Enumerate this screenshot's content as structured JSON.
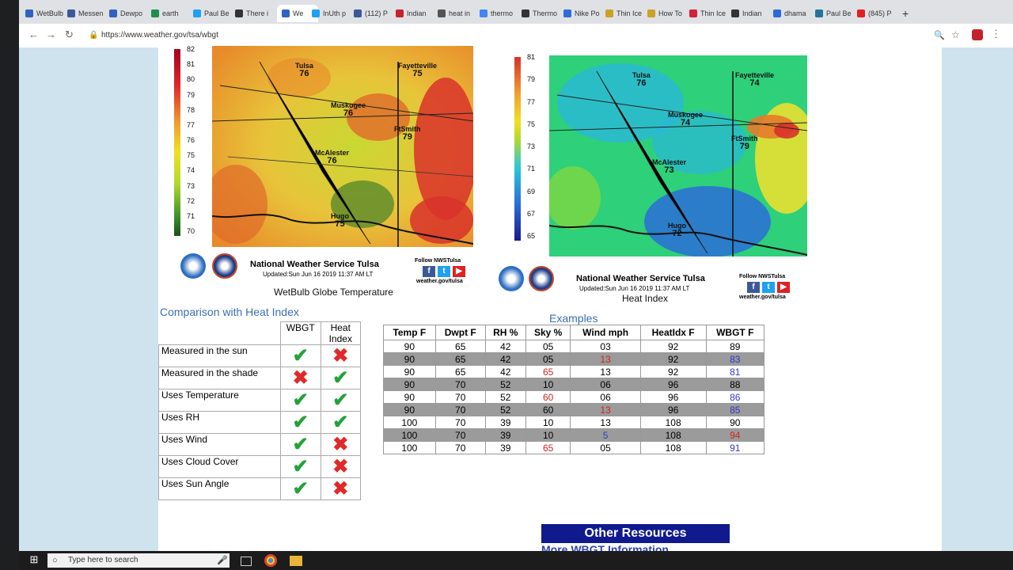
{
  "browser": {
    "tabs": [
      {
        "label": "WetBulb",
        "icon": "nws-icon",
        "color": "#3062c4"
      },
      {
        "label": "Messen",
        "icon": "facebook-icon",
        "color": "#3b5998"
      },
      {
        "label": "Dewpo",
        "icon": "nws-icon",
        "color": "#3062c4"
      },
      {
        "label": "earth",
        "icon": "sheet-icon",
        "color": "#1f8f4d"
      },
      {
        "label": "Paul Be",
        "icon": "twitter-icon",
        "color": "#1da1f2"
      },
      {
        "label": "There i",
        "icon": "page-icon",
        "color": "#333333"
      },
      {
        "label": "We",
        "icon": "nws-icon",
        "color": "#3062c4"
      },
      {
        "label": "InUth p",
        "icon": "twitter-icon",
        "color": "#1da1f2"
      },
      {
        "label": "(112) P",
        "icon": "facebook-icon",
        "color": "#3b5998"
      },
      {
        "label": "Indian",
        "icon": "news-icon",
        "color": "#c4232c"
      },
      {
        "label": "heat in",
        "icon": "page-icon",
        "color": "#555555"
      },
      {
        "label": "thermo",
        "icon": "google-icon",
        "color": "#4285f4"
      },
      {
        "label": "Thermo",
        "icon": "wikipedia-icon",
        "color": "#333333"
      },
      {
        "label": "Nike Po",
        "icon": "page-icon",
        "color": "#2e6bd8"
      },
      {
        "label": "Thin Ice",
        "icon": "page-icon",
        "color": "#c9a227"
      },
      {
        "label": "How To",
        "icon": "page-icon",
        "color": "#c9a227"
      },
      {
        "label": "Thin Ice",
        "icon": "page-icon",
        "color": "#d0223a"
      },
      {
        "label": "Indian",
        "icon": "page-icon",
        "color": "#333333"
      },
      {
        "label": "dhama",
        "icon": "page-icon",
        "color": "#2e6bd8"
      },
      {
        "label": "Paul Be",
        "icon": "wordpress-icon",
        "color": "#21759b"
      },
      {
        "label": "(845) P",
        "icon": "youtube-icon",
        "color": "#e02020"
      }
    ],
    "new_tab_label": "+",
    "url": "https://www.weather.gov/tsa/wbgt"
  },
  "maps": {
    "left": {
      "org": "National Weather Service Tulsa",
      "updated": "Updated:Sun Jun 16 2019 11:37 AM LT",
      "follow": "Follow NWSTulsa",
      "site": "weather.gov/tulsa",
      "caption": "WetBulb Globe Temperature",
      "scale": [
        "82",
        "81",
        "80",
        "79",
        "78",
        "77",
        "76",
        "75",
        "74",
        "73",
        "72",
        "71",
        "70"
      ],
      "cities": [
        {
          "name": "Tulsa",
          "val": "76"
        },
        {
          "name": "Fayetteville",
          "val": "75"
        },
        {
          "name": "Muskogee",
          "val": "76"
        },
        {
          "name": "FtSmith",
          "val": "79"
        },
        {
          "name": "McAlester",
          "val": "76"
        },
        {
          "name": "Hugo",
          "val": "75"
        }
      ],
      "roads": [
        "44",
        "40",
        "40",
        "71",
        "69"
      ]
    },
    "right": {
      "org": "National Weather Service Tulsa",
      "updated": "Updated:Sun Jun 16 2019 11:37 AM LT",
      "follow": "Follow NWSTulsa",
      "site": "weather.gov/tulsa",
      "caption": "Heat Index",
      "scale": [
        "81",
        "79",
        "77",
        "75",
        "73",
        "71",
        "69",
        "67",
        "65"
      ],
      "cities": [
        {
          "name": "Tulsa",
          "val": "76"
        },
        {
          "name": "Fayetteville",
          "val": "74"
        },
        {
          "name": "Muskogee",
          "val": "74"
        },
        {
          "name": "FtSmith",
          "val": "79"
        },
        {
          "name": "McAlester",
          "val": "73"
        },
        {
          "name": "Hugo",
          "val": "72"
        }
      ],
      "roads": [
        "44",
        "40",
        "40",
        "71",
        "69"
      ]
    }
  },
  "comparison": {
    "title": "Comparison with Heat Index",
    "headers": [
      "WBGT",
      "Heat Index"
    ],
    "rows": [
      {
        "label": "Measured in the sun",
        "wbgt": true,
        "hi": false
      },
      {
        "label": "Measured in the shade",
        "wbgt": false,
        "hi": true
      },
      {
        "label": "Uses Temperature",
        "wbgt": true,
        "hi": true
      },
      {
        "label": "Uses RH",
        "wbgt": true,
        "hi": true
      },
      {
        "label": "Uses Wind",
        "wbgt": true,
        "hi": false
      },
      {
        "label": "Uses Cloud Cover",
        "wbgt": true,
        "hi": false
      },
      {
        "label": "Uses Sun Angle",
        "wbgt": true,
        "hi": false
      }
    ]
  },
  "examples": {
    "title": "Examples",
    "headers": [
      "Temp F",
      "Dwpt F",
      "RH %",
      "Sky %",
      "Wind mph",
      "HeatIdx F",
      "WBGT F"
    ],
    "rows": [
      [
        {
          "v": "90"
        },
        {
          "v": "65"
        },
        {
          "v": "42"
        },
        {
          "v": "05"
        },
        {
          "v": "03"
        },
        {
          "v": "92"
        },
        {
          "v": "89"
        }
      ],
      [
        {
          "v": "90"
        },
        {
          "v": "65"
        },
        {
          "v": "42"
        },
        {
          "v": "05"
        },
        {
          "v": "13",
          "c": "red"
        },
        {
          "v": "92"
        },
        {
          "v": "83",
          "c": "blue"
        }
      ],
      [
        {
          "v": "90"
        },
        {
          "v": "65"
        },
        {
          "v": "42"
        },
        {
          "v": "65",
          "c": "red"
        },
        {
          "v": "13"
        },
        {
          "v": "92"
        },
        {
          "v": "81",
          "c": "blue"
        }
      ],
      [
        {
          "v": "90"
        },
        {
          "v": "70"
        },
        {
          "v": "52"
        },
        {
          "v": "10"
        },
        {
          "v": "06"
        },
        {
          "v": "96"
        },
        {
          "v": "88"
        }
      ],
      [
        {
          "v": "90"
        },
        {
          "v": "70"
        },
        {
          "v": "52"
        },
        {
          "v": "60",
          "c": "red"
        },
        {
          "v": "06"
        },
        {
          "v": "96"
        },
        {
          "v": "86",
          "c": "blue"
        }
      ],
      [
        {
          "v": "90"
        },
        {
          "v": "70"
        },
        {
          "v": "52"
        },
        {
          "v": "60"
        },
        {
          "v": "13",
          "c": "red"
        },
        {
          "v": "96"
        },
        {
          "v": "85",
          "c": "blue"
        }
      ],
      [
        {
          "v": "100"
        },
        {
          "v": "70"
        },
        {
          "v": "39"
        },
        {
          "v": "10"
        },
        {
          "v": "13"
        },
        {
          "v": "108"
        },
        {
          "v": "90"
        }
      ],
      [
        {
          "v": "100"
        },
        {
          "v": "70"
        },
        {
          "v": "39"
        },
        {
          "v": "10"
        },
        {
          "v": "5",
          "c": "blue"
        },
        {
          "v": "108"
        },
        {
          "v": "94",
          "c": "red"
        }
      ],
      [
        {
          "v": "100"
        },
        {
          "v": "70"
        },
        {
          "v": "39"
        },
        {
          "v": "65",
          "c": "red"
        },
        {
          "v": "05"
        },
        {
          "v": "108"
        },
        {
          "v": "91",
          "c": "blue"
        }
      ]
    ]
  },
  "resources": {
    "title": "Other Resources",
    "link": "More WBGT Information"
  },
  "taskbar": {
    "search": "Type here to search"
  }
}
